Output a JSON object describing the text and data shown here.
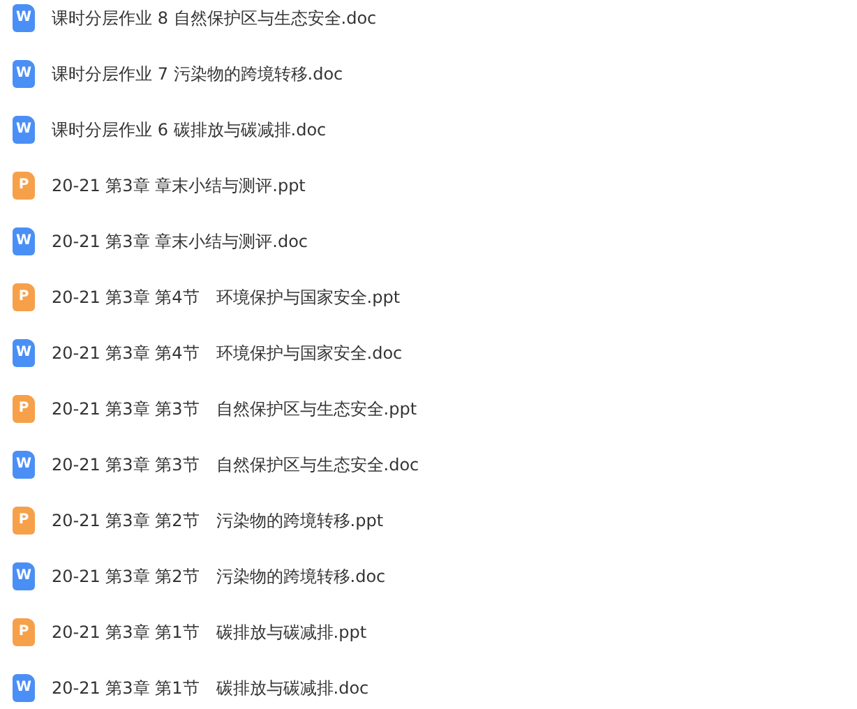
{
  "files": [
    {
      "kind": "doc",
      "badge": "W",
      "name": "课时分层作业 8 自然保护区与生态安全.doc"
    },
    {
      "kind": "doc",
      "badge": "W",
      "name": "课时分层作业 7 污染物的跨境转移.doc"
    },
    {
      "kind": "doc",
      "badge": "W",
      "name": "课时分层作业 6 碳排放与碳减排.doc"
    },
    {
      "kind": "ppt",
      "badge": "P",
      "name": "20-21 第3章 章末小结与测评.ppt"
    },
    {
      "kind": "doc",
      "badge": "W",
      "name": "20-21 第3章 章末小结与测评.doc"
    },
    {
      "kind": "ppt",
      "badge": "P",
      "name": "20-21 第3章 第4节　环境保护与国家安全.ppt"
    },
    {
      "kind": "doc",
      "badge": "W",
      "name": "20-21 第3章 第4节　环境保护与国家安全.doc"
    },
    {
      "kind": "ppt",
      "badge": "P",
      "name": "20-21 第3章 第3节　自然保护区与生态安全.ppt"
    },
    {
      "kind": "doc",
      "badge": "W",
      "name": "20-21 第3章 第3节　自然保护区与生态安全.doc"
    },
    {
      "kind": "ppt",
      "badge": "P",
      "name": "20-21 第3章 第2节　污染物的跨境转移.ppt"
    },
    {
      "kind": "doc",
      "badge": "W",
      "name": "20-21 第3章 第2节　污染物的跨境转移.doc"
    },
    {
      "kind": "ppt",
      "badge": "P",
      "name": "20-21 第3章 第1节　碳排放与碳减排.ppt"
    },
    {
      "kind": "doc",
      "badge": "W",
      "name": "20-21 第3章 第1节　碳排放与碳减排.doc"
    }
  ]
}
